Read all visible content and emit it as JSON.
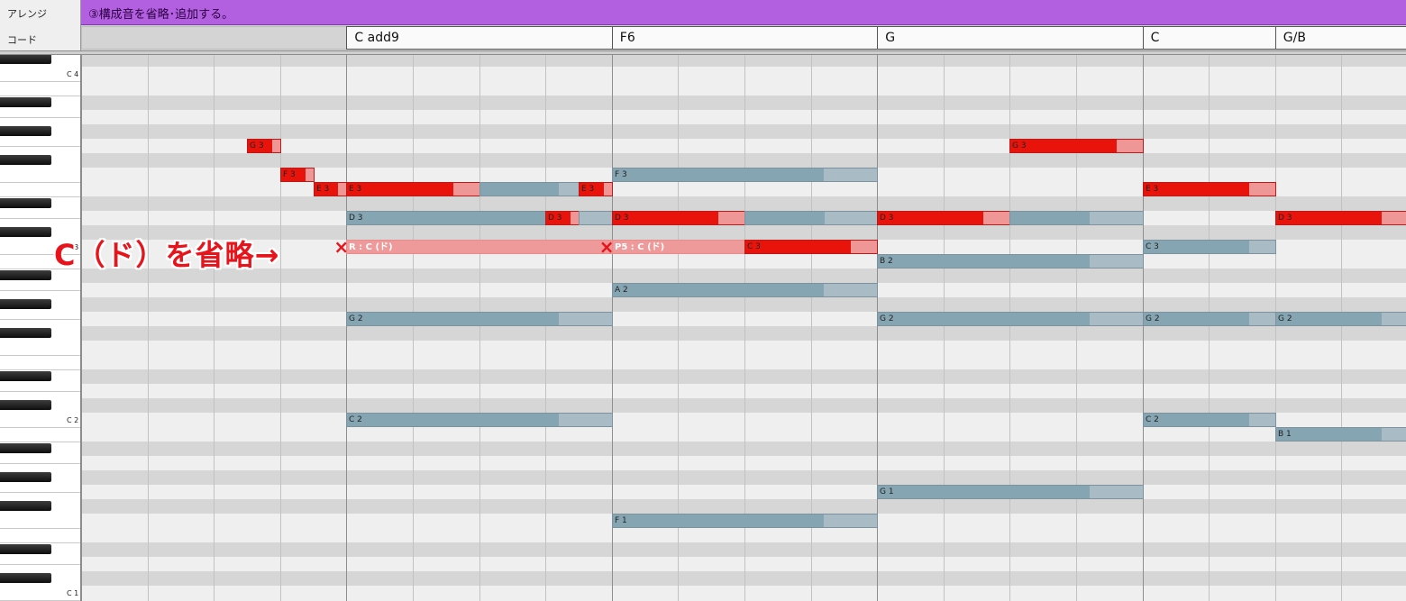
{
  "header": {
    "arrange_label": "アレンジ",
    "chord_label": "コード"
  },
  "arrange_lane": {
    "text": "③構成音を省略･追加する。"
  },
  "chords": [
    {
      "name": "",
      "start": 0,
      "len": 4
    },
    {
      "name": "C add9",
      "start": 4,
      "len": 4
    },
    {
      "name": "F6",
      "start": 8,
      "len": 4
    },
    {
      "name": "G",
      "start": 12,
      "len": 4
    },
    {
      "name": "C",
      "start": 16,
      "len": 2
    },
    {
      "name": "G/B",
      "start": 18,
      "len": 2
    }
  ],
  "keyboard": {
    "labels": [
      {
        "text": "C 4",
        "pitch": 60
      },
      {
        "text": "C 3",
        "pitch": 48
      },
      {
        "text": "C 2",
        "pitch": 36
      },
      {
        "text": "C 1",
        "pitch": 24
      }
    ]
  },
  "notes": [
    {
      "label": "G 3",
      "pitch": 55,
      "start": 2.5,
      "len": 0.5,
      "fill": 0.75,
      "style": "red"
    },
    {
      "label": "F 3",
      "pitch": 53,
      "start": 3,
      "len": 0.5,
      "fill": 0.75,
      "style": "red"
    },
    {
      "label": "E 3",
      "pitch": 52,
      "start": 3.5,
      "len": 0.5,
      "fill": 0.75,
      "style": "red"
    },
    {
      "label": "E 3",
      "pitch": 52,
      "start": 4,
      "len": 2,
      "fill": 0.8,
      "style": "red"
    },
    {
      "label": "",
      "pitch": 52,
      "start": 6,
      "len": 1.5,
      "fill": 0.8,
      "style": "blue"
    },
    {
      "label": "E 3",
      "pitch": 52,
      "start": 7.5,
      "len": 0.5,
      "fill": 0.75,
      "style": "red"
    },
    {
      "label": "D 3",
      "pitch": 50,
      "start": 4,
      "len": 3,
      "fill": 1,
      "style": "blue"
    },
    {
      "label": "D 3",
      "pitch": 50,
      "start": 7,
      "len": 0.5,
      "fill": 0.75,
      "style": "red"
    },
    {
      "label": "",
      "pitch": 50,
      "start": 7.5,
      "len": 0.5,
      "fill": 0,
      "style": "blue"
    },
    {
      "label": "R : C (ド)",
      "pitch": 48,
      "start": 4,
      "len": 4,
      "fill": 0,
      "style": "pink"
    },
    {
      "label": "G 2",
      "pitch": 43,
      "start": 4,
      "len": 4,
      "fill": 0.8,
      "style": "blue"
    },
    {
      "label": "C 2",
      "pitch": 36,
      "start": 4,
      "len": 4,
      "fill": 0.8,
      "style": "blue"
    },
    {
      "label": "F 3",
      "pitch": 53,
      "start": 8,
      "len": 4,
      "fill": 0.8,
      "style": "blue"
    },
    {
      "label": "D 3",
      "pitch": 50,
      "start": 8,
      "len": 2,
      "fill": 0.8,
      "style": "red"
    },
    {
      "label": "",
      "pitch": 50,
      "start": 10,
      "len": 2,
      "fill": 0.6,
      "style": "blue"
    },
    {
      "label": "P5 : C (ド)",
      "pitch": 48,
      "start": 8,
      "len": 2,
      "fill": 0,
      "style": "pink"
    },
    {
      "label": "C 3",
      "pitch": 48,
      "start": 10,
      "len": 2,
      "fill": 0.8,
      "style": "red"
    },
    {
      "label": "A 2",
      "pitch": 45,
      "start": 8,
      "len": 4,
      "fill": 0.8,
      "style": "blue"
    },
    {
      "label": "F 1",
      "pitch": 29,
      "start": 8,
      "len": 4,
      "fill": 0.8,
      "style": "blue"
    },
    {
      "label": "G 3",
      "pitch": 55,
      "start": 14,
      "len": 2,
      "fill": 0.8,
      "style": "red"
    },
    {
      "label": "D 3",
      "pitch": 50,
      "start": 12,
      "len": 2,
      "fill": 0.8,
      "style": "red"
    },
    {
      "label": "",
      "pitch": 50,
      "start": 14,
      "len": 2,
      "fill": 0.6,
      "style": "blue"
    },
    {
      "label": "B 2",
      "pitch": 47,
      "start": 12,
      "len": 4,
      "fill": 0.8,
      "style": "blue"
    },
    {
      "label": "G 2",
      "pitch": 43,
      "start": 12,
      "len": 4,
      "fill": 0.8,
      "style": "blue"
    },
    {
      "label": "G 1",
      "pitch": 31,
      "start": 12,
      "len": 4,
      "fill": 0.8,
      "style": "blue"
    },
    {
      "label": "E 3",
      "pitch": 52,
      "start": 16,
      "len": 2,
      "fill": 0.8,
      "style": "red"
    },
    {
      "label": "C 3",
      "pitch": 48,
      "start": 16,
      "len": 2,
      "fill": 0.8,
      "style": "blue"
    },
    {
      "label": "G 2",
      "pitch": 43,
      "start": 16,
      "len": 2,
      "fill": 0.8,
      "style": "blue"
    },
    {
      "label": "C 2",
      "pitch": 36,
      "start": 16,
      "len": 2,
      "fill": 0.8,
      "style": "blue"
    },
    {
      "label": "D 3",
      "pitch": 50,
      "start": 18,
      "len": 2,
      "fill": 0.8,
      "style": "red"
    },
    {
      "label": "G 2",
      "pitch": 43,
      "start": 18,
      "len": 2,
      "fill": 0.8,
      "style": "blue"
    },
    {
      "label": "B 1",
      "pitch": 35,
      "start": 18,
      "len": 2,
      "fill": 0.8,
      "style": "blue"
    }
  ],
  "markers": [
    {
      "text": "×",
      "pitch": 48,
      "beat": 4
    },
    {
      "text": "×",
      "pitch": 48,
      "beat": 8
    }
  ],
  "annotation": {
    "text": "C（ド）を省略→"
  },
  "colors": {
    "note_blue": "#86a5b2",
    "note_red": "#e8140c",
    "removed_note": "#ef9a9a",
    "arrange_lane": "#b25fe0",
    "annotation": "#e8141c"
  }
}
